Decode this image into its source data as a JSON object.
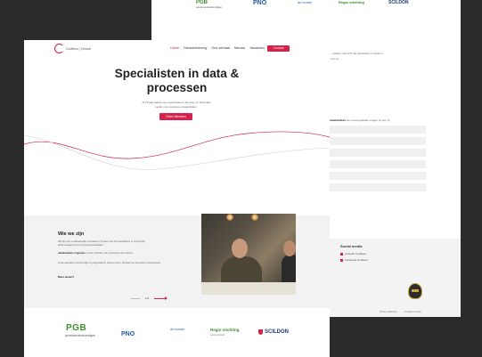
{
  "brand": {
    "accent": "#d6224a",
    "logo_text": "Codifeeu | Creach"
  },
  "nav": {
    "items": [
      "Home",
      "Dienstverlening",
      "Ons verhaal",
      "Nieuws",
      "Vacatures"
    ],
    "contact": "Contact"
  },
  "hero": {
    "title_line1": "Specialisten in data &",
    "title_line2": "processen",
    "subtitle": "Al 25 jaar helpen we organisaties in de zorg- en financiële sector met complexe vraagstukken.",
    "cta": "Onze diensten"
  },
  "about": {
    "title": "Wie we zijn",
    "p1": "Wij zijn een onafhankelijk consultancy bureau met 18 specialisten in zorgvuldig datamanagement en procesoptimalisatie.",
    "p2_bold": "datakwaliteit, migraties",
    "p2_rest": "en het inrichten van processen die werken.",
    "p3": "Onze aanpak is persoonlijk en pragmatisch: samen met u bouwen we duurzame oplossingen.",
    "link": "Meer weten?",
    "pager": "1/4"
  },
  "clients": {
    "pgb": "PGB",
    "pgb_sub": "pensioendeskundigen",
    "pno": "PNO",
    "dekoster": "de koster",
    "regio": "Regio stichting",
    "regio_sub": "pensioenfonds",
    "scildon": "SCILDON"
  },
  "back": {
    "side_text": "...stelling. Het CTT als activiteiten en actie in ons op...",
    "table_intro_bold": "datakwaliteit",
    "table_intro_rest": "De meest gestelde vragen op een rij.",
    "social_title": "Social media",
    "social_1": "Linkedin Codifeeu",
    "social_2": "Facebook Codifeeu",
    "links": [
      "Privacy statement",
      "Codifeeu Creach"
    ]
  }
}
